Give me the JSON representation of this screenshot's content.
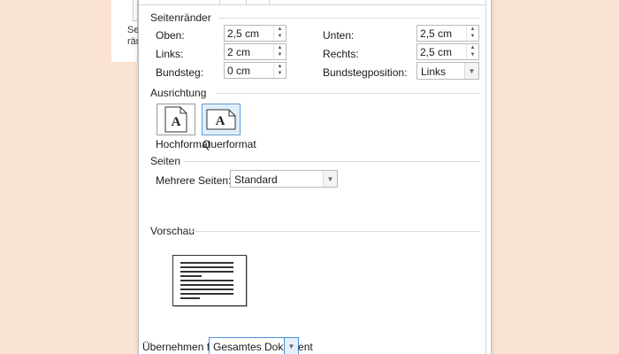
{
  "background_doc": {
    "text_lines": [
      "Se",
      "rän"
    ]
  },
  "margins": {
    "title": "Seitenränder",
    "top": {
      "label": "Oben:",
      "value": "2,5 cm"
    },
    "bottom": {
      "label": "Unten:",
      "value": "2,5 cm"
    },
    "left": {
      "label": "Links:",
      "value": "2 cm"
    },
    "right": {
      "label": "Rechts:",
      "value": "2,5 cm"
    },
    "gutter": {
      "label": "Bundsteg:",
      "value": "0 cm"
    },
    "gutter_position": {
      "label": "Bundstegposition:",
      "value": "Links"
    }
  },
  "orientation": {
    "title": "Ausrichtung",
    "portrait_label": "Hochformat",
    "landscape_label": "Querformat",
    "selected": "landscape",
    "icon_letter": "A"
  },
  "pages": {
    "title": "Seiten",
    "multiple_label": "Mehrere Seiten:",
    "multiple_value": "Standard"
  },
  "preview": {
    "title": "Vorschau"
  },
  "apply": {
    "label": "Übernehmen für:",
    "value": "Gesamtes Dokument"
  },
  "colors": {
    "desktop": "#fbe3d3",
    "accent": "#4a90d9",
    "selected_fill": "#dfeefb"
  }
}
